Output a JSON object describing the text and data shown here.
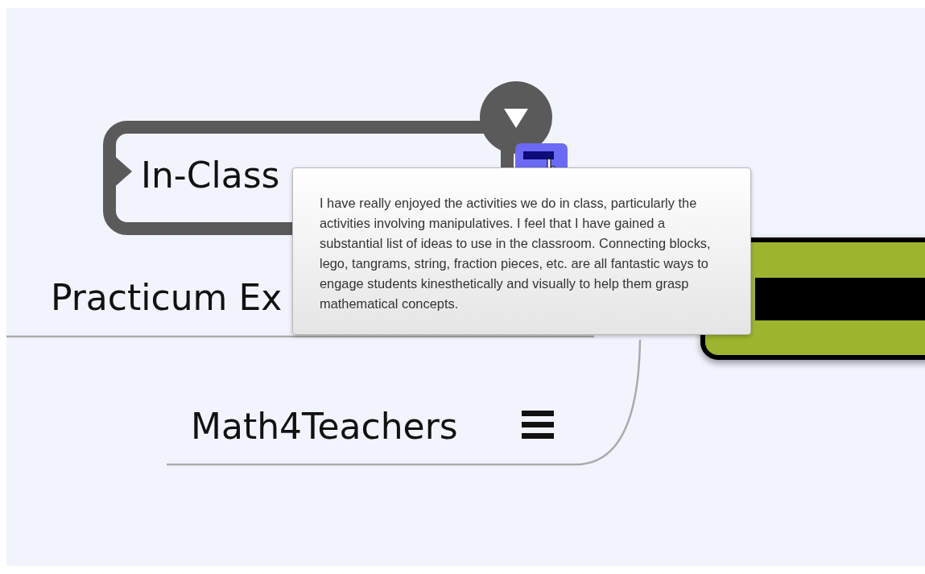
{
  "topics": [
    {
      "label": "In-Class",
      "kind": "outlined",
      "expanded": true,
      "note_highlighted": true
    },
    {
      "label": "Practicum Ex",
      "kind": "plain"
    },
    {
      "label": "Math4Teachers",
      "kind": "plain",
      "note_highlighted": false
    }
  ],
  "central_topic": {
    "color": "#9db52e"
  },
  "note_tooltip": {
    "text": "I have really enjoyed the activities we do in class, particularly the activities involving manipulatives. I feel that I have gained a substantial list of ideas to use in the classroom. Connecting blocks, lego, tangrams, string, fraction pieces, etc. are all fantastic ways to engage students kinesthetically and visually to help them grasp mathematical concepts."
  }
}
